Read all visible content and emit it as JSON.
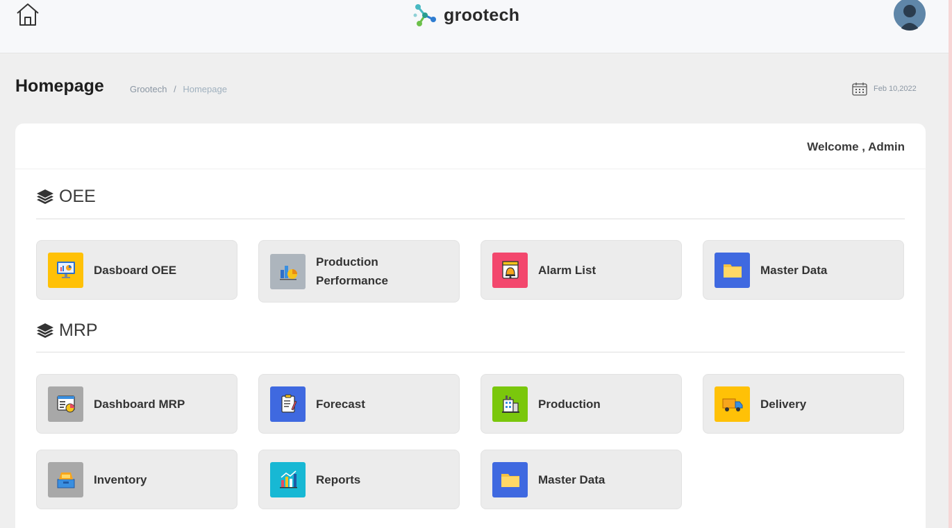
{
  "header": {
    "brand": "grootech"
  },
  "page": {
    "title": "Homepage",
    "breadcrumb": [
      "Grootech",
      "Homepage"
    ],
    "breadcrumb_separator": "/",
    "date": "Feb 10,2022"
  },
  "welcome": "Welcome , Admin",
  "sections": [
    {
      "title": "OEE",
      "tiles": [
        {
          "label": "Dasboard OEE",
          "icon": "dashboard-monitor-icon",
          "color": "#ffc107"
        },
        {
          "label": "Production Performance",
          "icon": "performance-chart-icon",
          "color": "#adb5bd"
        },
        {
          "label": "Alarm List",
          "icon": "alarm-bell-icon",
          "color": "#f3476d"
        },
        {
          "label": "Master Data",
          "icon": "folder-icon",
          "color": "#3f69e0"
        }
      ]
    },
    {
      "title": "MRP",
      "tiles": [
        {
          "label": "Dashboard MRP",
          "icon": "dashboard-report-icon",
          "color": "#a8a8a8"
        },
        {
          "label": "Forecast",
          "icon": "clipboard-icon",
          "color": "#3f69e0"
        },
        {
          "label": "Production",
          "icon": "factory-icon",
          "color": "#7ac70c"
        },
        {
          "label": "Delivery",
          "icon": "truck-icon",
          "color": "#ffc107"
        },
        {
          "label": "Inventory",
          "icon": "inventory-box-icon",
          "color": "#a8a8a8"
        },
        {
          "label": "Reports",
          "icon": "bar-chart-icon",
          "color": "#17b8d4"
        },
        {
          "label": "Master Data",
          "icon": "folder-icon",
          "color": "#3f69e0"
        }
      ]
    }
  ]
}
